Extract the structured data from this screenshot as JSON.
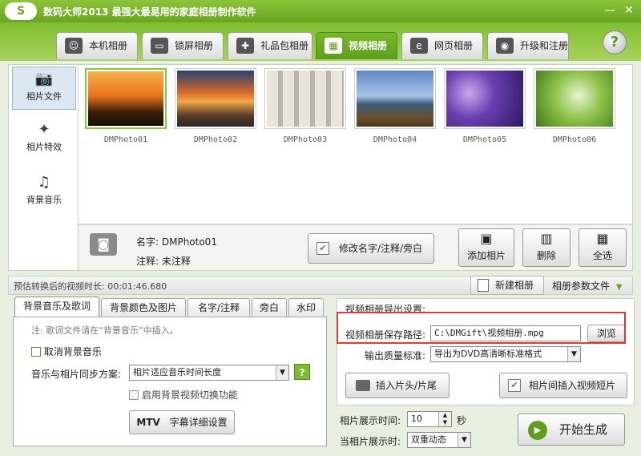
{
  "app": {
    "logo": "S",
    "title": "数码大师2013   最强大最易用的家庭相册制作软件"
  },
  "window": {
    "minimize": "—",
    "close": "✕"
  },
  "tabs": [
    {
      "label": "本机相册",
      "icon": "person-icon"
    },
    {
      "label": "锁屏相册",
      "icon": "monitor-icon"
    },
    {
      "label": "礼品包相册",
      "icon": "gift-icon"
    },
    {
      "label": "视频相册",
      "icon": "film-icon"
    },
    {
      "label": "网页相册",
      "icon": "ie-icon"
    },
    {
      "label": "升级和注册",
      "icon": "globe-icon"
    }
  ],
  "help": "?",
  "leftnav": [
    {
      "label": "相片文件",
      "icon": "camera-icon"
    },
    {
      "label": "相片特效",
      "icon": "sparkle-icon"
    },
    {
      "label": "背景音乐",
      "icon": "music-note-icon"
    }
  ],
  "photos": [
    {
      "name": "DMPhoto01"
    },
    {
      "name": "DMPhoto02"
    },
    {
      "name": "DMPhoto03"
    },
    {
      "name": "DMPhoto04"
    },
    {
      "name": "DMPhoto05"
    },
    {
      "name": "DMPhoto06"
    }
  ],
  "info": {
    "name_line": "名字: DMPhoto01",
    "note_line": "注释: 未注释",
    "edit_button": "修改名字/注释/旁白"
  },
  "actions": {
    "add": "添加相片",
    "delete": "删除",
    "select_all": "全选"
  },
  "status": {
    "duration": "预估转换后的视频时长: 00:01:46.680",
    "new_album": "新建相册",
    "params": "相册参数文件"
  },
  "subtabs": [
    "背景音乐及歌词",
    "背景颜色及图片",
    "名字/注释",
    "旁白",
    "水印"
  ],
  "music": {
    "note": "注: 歌词文件请在“背景音乐”中插入。",
    "cancel_bg": "取消背景音乐",
    "sync_label": "音乐与相片同步方案:",
    "sync_value": "相片适应音乐时间长度",
    "enable_switch": "启用背景视频切换功能",
    "mtv_badge": "MTV",
    "mtv_button": "字幕详细设置"
  },
  "export": {
    "header": "视频相册导出设置:",
    "path_label": "视频相册保存路径:",
    "path_value": "C:\\DMGift\\视频相册.mpg",
    "browse": "浏览",
    "quality_label": "输出质量标准:",
    "quality_value": "导出为DVD高清晰标准格式",
    "insert_head": "插入片头/片尾",
    "insert_clip": "相片间插入视频短片"
  },
  "timing": {
    "show_time_label": "相片展示时间:",
    "show_time_value": "10",
    "unit": "秒",
    "transition_label": "当相片展示时:",
    "transition_value": "双重动态"
  },
  "start": "开始生成"
}
